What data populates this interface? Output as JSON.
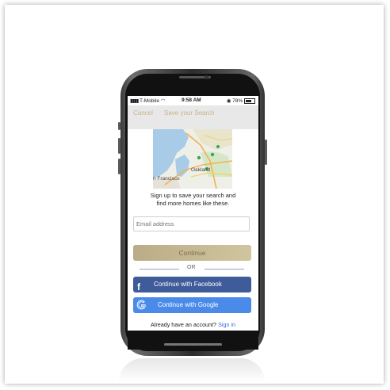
{
  "status_bar": {
    "carrier": "T-Mobile",
    "time": "9:58 AM",
    "battery": "78%"
  },
  "header": {
    "cancel_label": "Cancel",
    "title": "Save your Search"
  },
  "map": {
    "labels": [
      "Oakland",
      "n Francisco"
    ]
  },
  "signup": {
    "line1": "Sign up to save your search and",
    "line2": "find more homes like these."
  },
  "email_input": {
    "placeholder": "Email address",
    "value": ""
  },
  "buttons": {
    "continue_label": "Continue",
    "or_label": "OR",
    "facebook_label": "Continue with Facebook",
    "google_label": "Continue with Google"
  },
  "footer": {
    "prompt": "Already have an account?",
    "signin_label": "Sign in"
  },
  "colors": {
    "accent_gold": "#c9b38a",
    "facebook_blue": "#3f5c9a",
    "google_blue": "#4a8ae9",
    "link_blue": "#3f6bd6"
  }
}
